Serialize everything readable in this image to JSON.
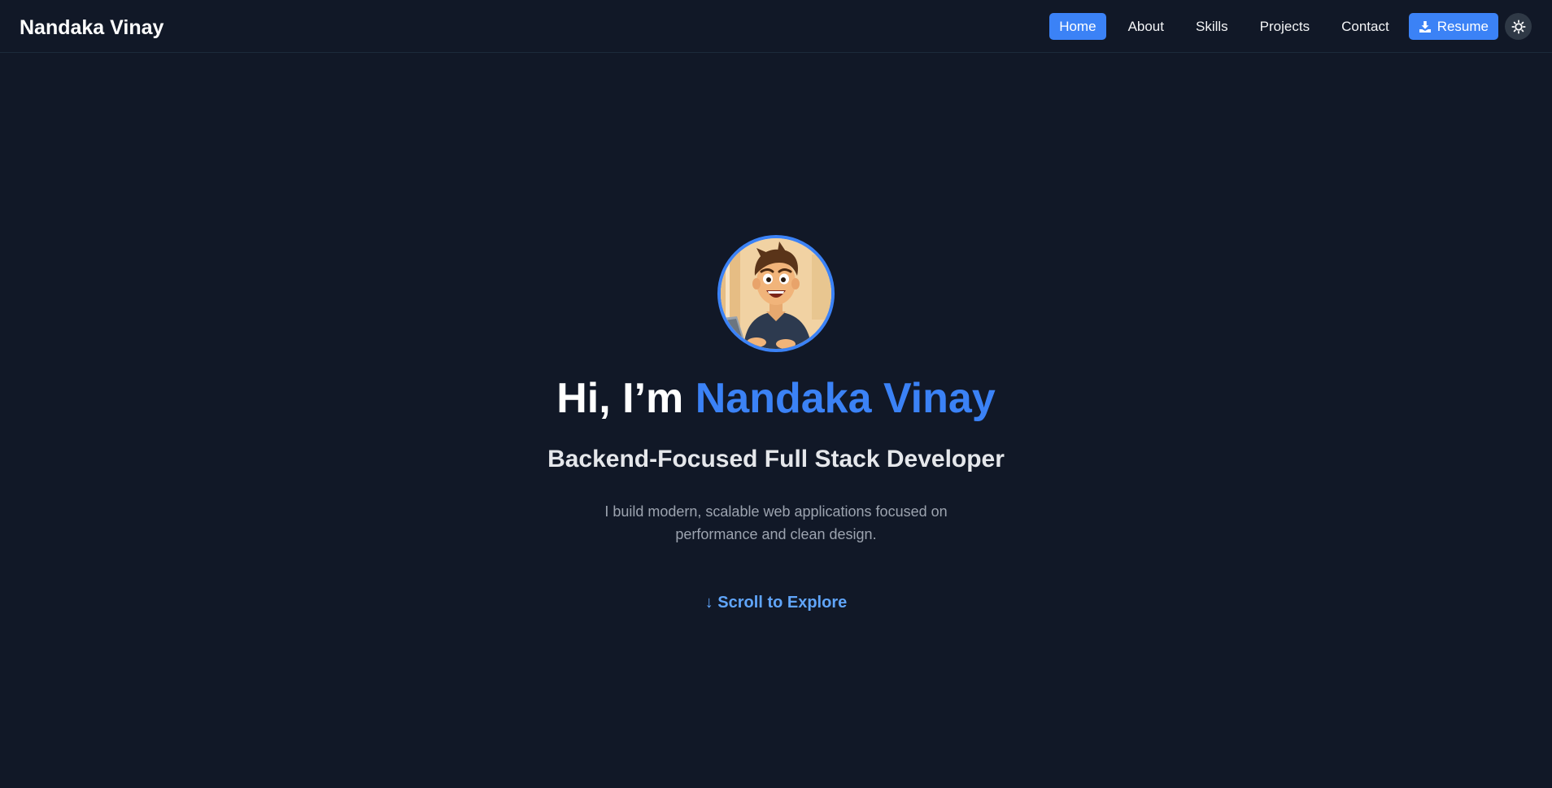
{
  "brand": {
    "name": "Nandaka Vinay"
  },
  "nav": {
    "links": [
      {
        "label": "Home",
        "active": true
      },
      {
        "label": "About",
        "active": false
      },
      {
        "label": "Skills",
        "active": false
      },
      {
        "label": "Projects",
        "active": false
      },
      {
        "label": "Contact",
        "active": false
      }
    ],
    "resume_label": "Resume",
    "resume_icon": "download-icon",
    "theme_icon": "sun-icon"
  },
  "hero": {
    "greeting": "Hi, I’m",
    "name": "Nandaka Vinay",
    "subtitle": "Backend-Focused Full Stack Developer",
    "description": "I build modern, scalable web applications focused on performance and clean design.",
    "scroll_cta": "↓ Scroll to Explore"
  },
  "colors": {
    "background": "#111827",
    "accent": "#3b82f6",
    "link": "#60a5fa"
  }
}
